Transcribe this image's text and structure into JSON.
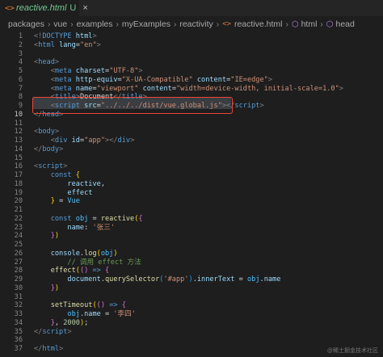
{
  "tab": {
    "icon": "<>",
    "title": "reactive.html",
    "status": "U",
    "close": "×"
  },
  "breadcrumb": {
    "parts": [
      "packages",
      "vue",
      "examples",
      "myExamples",
      "reactivity"
    ],
    "file_icon": "<>",
    "file": "reactive.html",
    "html_icon": "cube-icon",
    "html": "html",
    "head_icon": "cube-icon",
    "head": "head"
  },
  "lines": [
    {
      "n": "1",
      "tokens": [
        [
          "<!",
          "punct"
        ],
        [
          "DOCTYPE",
          "tag"
        ],
        [
          " html",
          "attr"
        ],
        [
          ">",
          "punct"
        ]
      ]
    },
    {
      "n": "2",
      "tokens": [
        [
          "<",
          "punct"
        ],
        [
          "html",
          "tag"
        ],
        [
          " lang",
          "attr"
        ],
        [
          "=",
          "plain"
        ],
        [
          "\"en\"",
          "str"
        ],
        [
          ">",
          "punct"
        ]
      ]
    },
    {
      "n": "3",
      "tokens": []
    },
    {
      "n": "4",
      "tokens": [
        [
          "<",
          "punct"
        ],
        [
          "head",
          "tag"
        ],
        [
          ">",
          "punct"
        ]
      ]
    },
    {
      "n": "5",
      "tokens": [
        [
          "    ",
          "plain"
        ],
        [
          "<",
          "punct"
        ],
        [
          "meta",
          "tag"
        ],
        [
          " charset",
          "attr"
        ],
        [
          "=",
          "plain"
        ],
        [
          "\"UTF-8\"",
          "str"
        ],
        [
          ">",
          "punct"
        ]
      ]
    },
    {
      "n": "6",
      "tokens": [
        [
          "    ",
          "plain"
        ],
        [
          "<",
          "punct"
        ],
        [
          "meta",
          "tag"
        ],
        [
          " http-equiv",
          "attr"
        ],
        [
          "=",
          "plain"
        ],
        [
          "\"X-UA-Compatible\"",
          "str"
        ],
        [
          " content",
          "attr"
        ],
        [
          "=",
          "plain"
        ],
        [
          "\"IE=edge\"",
          "str"
        ],
        [
          ">",
          "punct"
        ]
      ]
    },
    {
      "n": "7",
      "tokens": [
        [
          "    ",
          "plain"
        ],
        [
          "<",
          "punct"
        ],
        [
          "meta",
          "tag"
        ],
        [
          " name",
          "attr"
        ],
        [
          "=",
          "plain"
        ],
        [
          "\"viewport\"",
          "str"
        ],
        [
          " content",
          "attr"
        ],
        [
          "=",
          "plain"
        ],
        [
          "\"width=device-width, initial-scale=1.0\"",
          "str"
        ],
        [
          ">",
          "punct"
        ]
      ]
    },
    {
      "n": "8",
      "tokens": [
        [
          "    ",
          "plain"
        ],
        [
          "<",
          "punct"
        ],
        [
          "title",
          "tag"
        ],
        [
          ">",
          "punct"
        ],
        [
          "Document",
          "plain"
        ],
        [
          "</",
          "punct"
        ],
        [
          "title",
          "tag"
        ],
        [
          ">",
          "punct"
        ]
      ]
    },
    {
      "n": "9",
      "tokens": [
        [
          "    ",
          "plain"
        ],
        [
          "<",
          "punct"
        ],
        [
          "script",
          "tag"
        ],
        [
          " src",
          "attr"
        ],
        [
          "=",
          "plain"
        ],
        [
          "\"../../../dist/vue.global.js\"",
          "str"
        ],
        [
          "></",
          "punct"
        ],
        [
          "script",
          "tag"
        ],
        [
          ">",
          "punct"
        ]
      ]
    },
    {
      "n": "10",
      "tokens": [
        [
          "</",
          "punct"
        ],
        [
          "head",
          "tag"
        ],
        [
          ">",
          "punct"
        ]
      ]
    },
    {
      "n": "11",
      "tokens": []
    },
    {
      "n": "12",
      "tokens": [
        [
          "<",
          "punct"
        ],
        [
          "body",
          "tag"
        ],
        [
          ">",
          "punct"
        ]
      ]
    },
    {
      "n": "13",
      "tokens": [
        [
          "    ",
          "plain"
        ],
        [
          "<",
          "punct"
        ],
        [
          "div",
          "tag"
        ],
        [
          " id",
          "attr"
        ],
        [
          "=",
          "plain"
        ],
        [
          "\"app\"",
          "str"
        ],
        [
          "></",
          "punct"
        ],
        [
          "div",
          "tag"
        ],
        [
          ">",
          "punct"
        ]
      ]
    },
    {
      "n": "14",
      "tokens": [
        [
          "</",
          "punct"
        ],
        [
          "body",
          "tag"
        ],
        [
          ">",
          "punct"
        ]
      ]
    },
    {
      "n": "15",
      "tokens": []
    },
    {
      "n": "16",
      "tokens": [
        [
          "<",
          "punct"
        ],
        [
          "script",
          "tag"
        ],
        [
          ">",
          "punct"
        ]
      ]
    },
    {
      "n": "17",
      "tokens": [
        [
          "    ",
          "plain"
        ],
        [
          "const",
          "kw"
        ],
        [
          " ",
          "plain"
        ],
        [
          "{",
          "brk1"
        ]
      ]
    },
    {
      "n": "18",
      "tokens": [
        [
          "        ",
          "plain"
        ],
        [
          "reactive",
          "var"
        ],
        [
          ",",
          "plain"
        ]
      ]
    },
    {
      "n": "19",
      "tokens": [
        [
          "        ",
          "plain"
        ],
        [
          "effect",
          "var"
        ]
      ]
    },
    {
      "n": "20",
      "tokens": [
        [
          "    ",
          "plain"
        ],
        [
          "}",
          "brk1"
        ],
        [
          " = ",
          "plain"
        ],
        [
          "Vue",
          "const"
        ]
      ]
    },
    {
      "n": "21",
      "tokens": []
    },
    {
      "n": "22",
      "tokens": [
        [
          "    ",
          "plain"
        ],
        [
          "const",
          "kw"
        ],
        [
          " ",
          "plain"
        ],
        [
          "obj",
          "const"
        ],
        [
          " = ",
          "plain"
        ],
        [
          "reactive",
          "fn"
        ],
        [
          "(",
          "brk1"
        ],
        [
          "{",
          "brk2"
        ]
      ]
    },
    {
      "n": "23",
      "tokens": [
        [
          "        ",
          "plain"
        ],
        [
          "name",
          "var"
        ],
        [
          ": ",
          "plain"
        ],
        [
          "'张三'",
          "str"
        ]
      ]
    },
    {
      "n": "24",
      "tokens": [
        [
          "    ",
          "plain"
        ],
        [
          "}",
          "brk2"
        ],
        [
          ")",
          "brk1"
        ]
      ]
    },
    {
      "n": "25",
      "tokens": []
    },
    {
      "n": "26",
      "tokens": [
        [
          "    ",
          "plain"
        ],
        [
          "console",
          "var"
        ],
        [
          ".",
          "plain"
        ],
        [
          "log",
          "fn"
        ],
        [
          "(",
          "brk1"
        ],
        [
          "obj",
          "const"
        ],
        [
          ")",
          "brk1"
        ]
      ]
    },
    {
      "n": "27",
      "tokens": [
        [
          "        ",
          "plain"
        ],
        [
          "// 调用 effect 方法",
          "cmt"
        ]
      ]
    },
    {
      "n": "28",
      "tokens": [
        [
          "    ",
          "plain"
        ],
        [
          "effect",
          "fn"
        ],
        [
          "(",
          "brk1"
        ],
        [
          "(",
          "brk2"
        ],
        [
          ")",
          "brk2"
        ],
        [
          " => ",
          "kw"
        ],
        [
          "{",
          "brk2"
        ]
      ]
    },
    {
      "n": "29",
      "tokens": [
        [
          "        ",
          "plain"
        ],
        [
          "document",
          "var"
        ],
        [
          ".",
          "plain"
        ],
        [
          "querySelector",
          "fn"
        ],
        [
          "(",
          "brk3"
        ],
        [
          "'#app'",
          "str"
        ],
        [
          ")",
          "brk3"
        ],
        [
          ".",
          "plain"
        ],
        [
          "innerText",
          "var"
        ],
        [
          " = ",
          "plain"
        ],
        [
          "obj",
          "const"
        ],
        [
          ".",
          "plain"
        ],
        [
          "name",
          "var"
        ]
      ]
    },
    {
      "n": "30",
      "tokens": [
        [
          "    ",
          "plain"
        ],
        [
          "}",
          "brk2"
        ],
        [
          ")",
          "brk1"
        ]
      ]
    },
    {
      "n": "31",
      "tokens": []
    },
    {
      "n": "32",
      "tokens": [
        [
          "    ",
          "plain"
        ],
        [
          "setTimeout",
          "fn"
        ],
        [
          "(",
          "brk1"
        ],
        [
          "(",
          "brk2"
        ],
        [
          ")",
          "brk2"
        ],
        [
          " => ",
          "kw"
        ],
        [
          "{",
          "brk2"
        ]
      ]
    },
    {
      "n": "33",
      "tokens": [
        [
          "        ",
          "plain"
        ],
        [
          "obj",
          "const"
        ],
        [
          ".",
          "plain"
        ],
        [
          "name",
          "var"
        ],
        [
          " = ",
          "plain"
        ],
        [
          "'李四'",
          "str"
        ]
      ]
    },
    {
      "n": "34",
      "tokens": [
        [
          "    ",
          "plain"
        ],
        [
          "}",
          "brk2"
        ],
        [
          ", ",
          "plain"
        ],
        [
          "2000",
          "num"
        ],
        [
          ")",
          "brk1"
        ],
        [
          ";",
          "plain"
        ]
      ]
    },
    {
      "n": "35",
      "tokens": [
        [
          "</",
          "punct"
        ],
        [
          "script",
          "tag"
        ],
        [
          ">",
          "punct"
        ]
      ]
    },
    {
      "n": "36",
      "tokens": []
    },
    {
      "n": "37",
      "tokens": [
        [
          "</",
          "punct"
        ],
        [
          "html",
          "tag"
        ],
        [
          ">",
          "punct"
        ]
      ]
    }
  ],
  "active_line": "10",
  "watermark": "@稀土掘金技术社区"
}
